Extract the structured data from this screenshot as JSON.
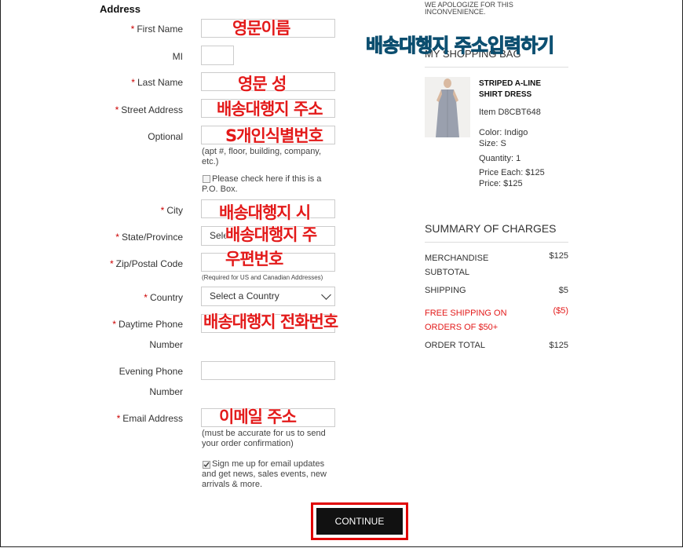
{
  "form": {
    "section_title": "Address",
    "required_marker": "*",
    "fields": {
      "first_name": "First Name",
      "mi": "MI",
      "last_name": "Last Name",
      "street": "Street Address",
      "optional": "Optional",
      "optional_hint": "(apt #, floor, building, company, etc.)",
      "po_box": "Please check here if this is a P.O. Box.",
      "city": "City",
      "state": "State/Province",
      "state_value": "Sele",
      "zip": "Zip/Postal Code",
      "zip_hint": "(Required for US and Canadian Addresses)",
      "country": "Country",
      "country_value": "Select a Country",
      "daytime_phone_1": "Daytime Phone",
      "daytime_phone_2": "Number",
      "evening_phone_1": "Evening Phone",
      "evening_phone_2": "Number",
      "email": "Email Address",
      "email_hint": "(must be accurate for us to send your order confirmation)",
      "signup": "Sign me up for email updates and get news, sales events, new arrivals & more."
    },
    "continue_label": "CONTINUE"
  },
  "annotations": {
    "main": "배송대행지 주소입력하기",
    "first_name": "영문이름",
    "last_name": "영문 성",
    "street": "배송대행지 주소",
    "optional": "S개인식별번호",
    "city": "배송대행지 시",
    "state": "배송대행지 주",
    "zip": "우편번호",
    "phone": "배송대행지 전화번호",
    "email": "이메일 주소"
  },
  "sidebar": {
    "apology": "WE APOLOGIZE FOR THIS INCONVENIENCE.",
    "bag_title": "MY SHOPPING BAG",
    "item": {
      "name_1": "STRIPED A-LINE",
      "name_2": "SHIRT DRESS",
      "item_no": "Item D8CBT648",
      "color": "Color: Indigo",
      "size": "Size: S",
      "quantity": "Quantity:  1",
      "price_each": "Price Each:  $125",
      "price": "Price:  $125"
    },
    "summary_title": "SUMMARY OF CHARGES",
    "summary": {
      "merch_1": "MERCHANDISE",
      "merch_2": "SUBTOTAL",
      "merch_value": "$125",
      "shipping": "SHIPPING",
      "shipping_value": "$5",
      "free_1": "FREE SHIPPING ON",
      "free_2": "ORDERS OF $50+",
      "free_value": "($5)",
      "total": "ORDER TOTAL",
      "total_value": "$125"
    }
  },
  "colors": {
    "accent_red": "#e31a1a",
    "overlay_blue": "#1f9ed1",
    "button_bg": "#111111"
  }
}
